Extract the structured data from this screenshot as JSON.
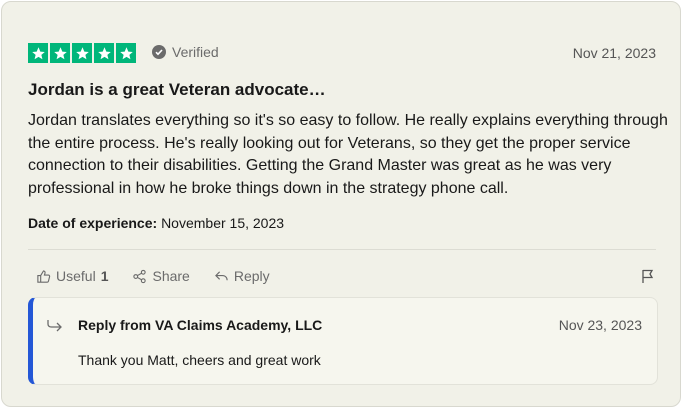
{
  "review": {
    "rating": 5,
    "verified_label": "Verified",
    "date": "Nov 21, 2023",
    "title": "Jordan is a great Veteran advocate…",
    "body": "Jordan translates everything so it's so easy to follow. He really explains everything through the entire process. He's really looking out for Veterans, so they get the proper service connection to their disabilities. Getting the Grand Master was great as he was very professional in how he broke things down in the strategy phone call.",
    "experience_label": "Date of experience:",
    "experience_date": "November 15, 2023"
  },
  "actions": {
    "useful_label": "Useful",
    "useful_count": "1",
    "share_label": "Share",
    "reply_label": "Reply"
  },
  "reply": {
    "from": "Reply from VA Claims Academy, LLC",
    "date": "Nov 23, 2023",
    "text": "Thank you Matt, cheers and great work"
  },
  "colors": {
    "star_green": "#00b67a",
    "reply_accent": "#2457d6",
    "card_background": "#f1f1e8"
  },
  "icons": [
    "star-icon",
    "verified-check-icon",
    "thumbs-up-icon",
    "share-icon",
    "reply-icon",
    "flag-icon",
    "reply-arrow-icon"
  ]
}
